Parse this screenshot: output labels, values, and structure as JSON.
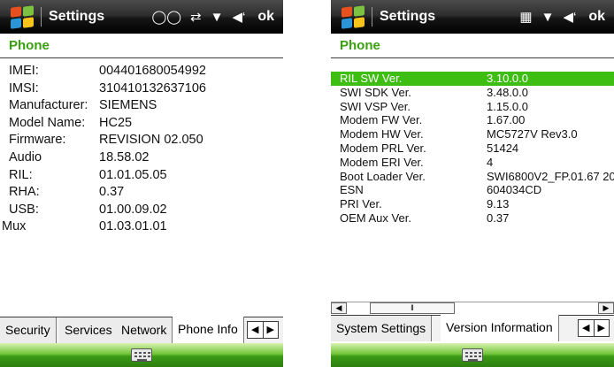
{
  "left": {
    "titlebar": {
      "title": "Settings",
      "ok": "ok"
    },
    "page_title": "Phone",
    "rows": [
      {
        "label": "IMEI:",
        "value": "004401680054992"
      },
      {
        "label": "IMSI:",
        "value": "310410132637106"
      },
      {
        "label": "Manufacturer:",
        "value": "SIEMENS"
      },
      {
        "label": "Model Name:",
        "value": "HC25"
      },
      {
        "label": "Firmware:",
        "value": "REVISION 02.050"
      },
      {
        "label": "Audio",
        "value": "18.58.02"
      },
      {
        "label": "RIL:",
        "value": "01.01.05.05"
      },
      {
        "label": "RHA:",
        "value": "0.37"
      },
      {
        "label": "USB:",
        "value": "01.00.09.02"
      },
      {
        "label": "Mux",
        "value": "01.03.01.01"
      }
    ],
    "tabs": [
      "Security",
      "Services",
      "Network",
      "Phone Info"
    ]
  },
  "right": {
    "titlebar": {
      "title": "Settings",
      "ok": "ok"
    },
    "page_title": "Phone",
    "rows": [
      {
        "label": "RIL SW Ver.",
        "value": "3.10.0.0",
        "selected": true
      },
      {
        "label": "SWI SDK Ver.",
        "value": "3.48.0.0"
      },
      {
        "label": "SWI VSP Ver.",
        "value": "1.15.0.0"
      },
      {
        "label": "Modem FW Ver.",
        "value": "1.67.00"
      },
      {
        "label": "Modem HW Ver.",
        "value": "MC5727V Rev3.0"
      },
      {
        "label": "Modem PRL Ver.",
        "value": "51424"
      },
      {
        "label": "Modem ERI Ver.",
        "value": "4"
      },
      {
        "label": "Boot Loader Ver.",
        "value": "SWI6800V2_FP.01.67 20"
      },
      {
        "label": "ESN",
        "value": "604034CD"
      },
      {
        "label": "PRI Ver.",
        "value": "9.13"
      },
      {
        "label": "OEM Aux Ver.",
        "value": "0.37"
      }
    ],
    "tabs": [
      "System Settings",
      "Version Information"
    ]
  },
  "icons": {
    "status_left": [
      "voicemail-icon",
      "data-transfer-icon",
      "signal-icon",
      "volume-icon"
    ],
    "status_right": [
      "connection-icon",
      "signal-icon",
      "volume-icon"
    ],
    "tab_scroll": [
      "left-arrow-icon",
      "right-arrow-icon"
    ],
    "bottom": "keyboard-icon"
  },
  "colors": {
    "accent_green": "#39a00f",
    "selection": "#3ebd12",
    "bottom_bar": "#3c9a16"
  }
}
